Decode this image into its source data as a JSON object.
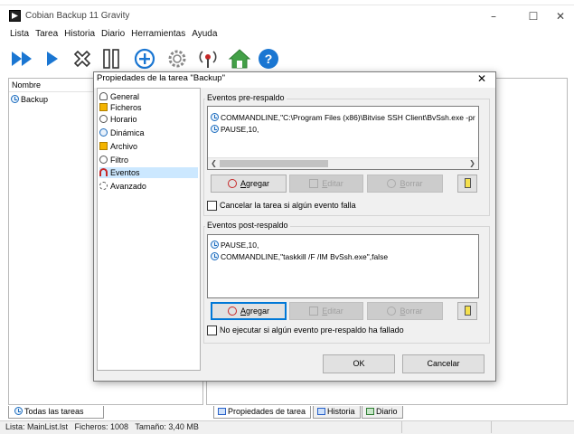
{
  "window": {
    "title": "Cobian Backup 11 Gravity",
    "minimize": "–",
    "maximize": "☐",
    "close": "✕"
  },
  "menu": [
    "Lista",
    "Tarea",
    "Historia",
    "Diario",
    "Herramientas",
    "Ayuda"
  ],
  "toolbar_icons": [
    "run-all-icon",
    "run-icon",
    "stop-icon",
    "pause-icon",
    "add-task-icon",
    "settings-icon",
    "antenna-icon",
    "home-icon",
    "help-icon"
  ],
  "left_panel": {
    "column_header": "Nombre",
    "tree_item": "Backup"
  },
  "bottom": {
    "left_tab": "Todas las tareas",
    "tabs": [
      "Propiedades de tarea",
      "Historia",
      "Diario"
    ],
    "status": "Lista: MainList.lst   Ficheros: 1008   Tamaño: 3,40 MB"
  },
  "dialog": {
    "title": "Propiedades de la tarea \"Backup\"",
    "close": "✕",
    "categories": [
      {
        "label": "General",
        "icon": "general-icon"
      },
      {
        "label": "Ficheros",
        "icon": "files-icon"
      },
      {
        "label": "Horario",
        "icon": "schedule-icon"
      },
      {
        "label": "Dinámica",
        "icon": "dynamic-icon"
      },
      {
        "label": "Archivo",
        "icon": "archive-icon"
      },
      {
        "label": "Filtro",
        "icon": "filter-icon"
      },
      {
        "label": "Eventos",
        "icon": "events-icon",
        "selected": true
      },
      {
        "label": "Avanzado",
        "icon": "advanced-icon"
      }
    ],
    "pre": {
      "label": "Eventos pre-respaldo",
      "items": [
        "COMMANDLINE,\"C:\\Program Files (x86)\\Bitvise SSH Client\\BvSsh.exe -pr",
        "PAUSE,10,"
      ],
      "checkbox": "Cancelar la tarea si algún evento falla"
    },
    "post": {
      "label": "Eventos post-respaldo",
      "items": [
        "PAUSE,10,",
        "COMMANDLINE,\"taskkill /F /IM BvSsh.exe\",false"
      ],
      "checkbox": "No ejecutar si algún evento pre-respaldo ha fallado"
    },
    "buttons": {
      "add_u": "A",
      "add_rest": "gregar",
      "edit_u": "E",
      "edit_rest": "ditar",
      "delete_u": "B",
      "delete_rest": "orrar"
    },
    "ok": "OK",
    "cancel": "Cancelar"
  },
  "colors": {
    "accent": "#0078d7",
    "selection": "#cce8ff",
    "toolbar_blue": "#1a76d2"
  }
}
